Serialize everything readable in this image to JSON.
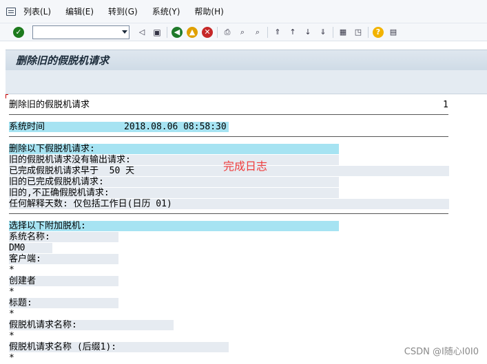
{
  "menu": {
    "items": [
      "列表(L)",
      "编辑(E)",
      "转到(G)",
      "系统(Y)",
      "帮助(H)"
    ]
  },
  "toolbar": {
    "command_value": ""
  },
  "title": "删除旧的假脱机请求",
  "report": {
    "header": "删除旧的假脱机请求",
    "page": "1",
    "system_time_label": "系统时间",
    "system_time_value": "2018.08.06 08:58:30",
    "lines": [
      "删除以下假脱机请求:",
      "旧的假脱机请求没有输出请求:",
      "已完成假脱机请求早于  50 天",
      "旧的已完成假脱机请求:",
      "旧的,不正确假脱机请求:",
      "任何解释天数: 仅包括工作日(日历 01)"
    ],
    "lines2": [
      "选择以下附加脱机:",
      "系统名称:",
      "DM0",
      "客户端:",
      "*",
      "创建者",
      "*",
      "标题:",
      "*",
      "假脱机请求名称:",
      "*",
      "假脱机请求名称 (后缀1):",
      "*"
    ]
  },
  "annotation": "完成日志",
  "watermark": "CSDN @I随心I0I0"
}
